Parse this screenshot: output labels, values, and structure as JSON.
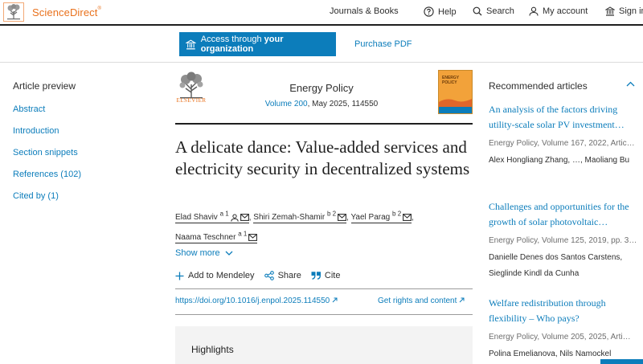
{
  "header": {
    "brand": "ScienceDirect",
    "brand_mark": "®",
    "nav": {
      "journals": "Journals & Books",
      "help": "Help",
      "search": "Search",
      "account": "My account",
      "signin": "Sign in"
    }
  },
  "access": {
    "button_prefix": "Access through ",
    "button_bold": "your organization",
    "purchase": "Purchase PDF"
  },
  "sidebar": {
    "title": "Article preview",
    "items": [
      {
        "label": "Abstract"
      },
      {
        "label": "Introduction"
      },
      {
        "label": "Section snippets"
      },
      {
        "label": "References (102)"
      },
      {
        "label": "Cited by (1)"
      }
    ]
  },
  "article": {
    "publisher_word": "ELSEVIER",
    "journal": "Energy Policy",
    "volume": "Volume 200",
    "volume_rest": ", May 2025, 114550",
    "cover_title": "ENERGY POLICY",
    "title": "A delicate dance: Value-added services and electricity security in decentralized systems",
    "authors": [
      {
        "name": "Elad Shaviv",
        "sup": "a 1"
      },
      {
        "name": "Shiri Zemah-Shamir",
        "sup": "b 2"
      },
      {
        "name": "Yael Parag",
        "sup": "b 2"
      },
      {
        "name": "Naama Teschner",
        "sup": "a 1"
      }
    ],
    "separator": ",",
    "show_more": "Show more",
    "actions": {
      "mendeley": "Add to Mendeley",
      "share": "Share",
      "cite": "Cite"
    },
    "doi": "https://doi.org/10.1016/j.enpol.2025.114550",
    "rights": "Get rights and content",
    "highlights": "Highlights"
  },
  "recommended": {
    "title": "Recommended articles",
    "items": [
      {
        "title": "An analysis of the factors driving utility-scale solar PV investment…",
        "meta": "Energy Policy, Volume 167, 2022, Artic…",
        "authors": "Alex Hongliang Zhang, …, Maoliang Bu"
      },
      {
        "title": "Challenges and opportunities for the growth of solar photovoltaic…",
        "meta": "Energy Policy, Volume 125, 2019, pp. 3…",
        "authors": "Danielle Denes dos Santos Carstens, Sieglinde Kindl da Cunha"
      },
      {
        "title": "Welfare redistribution through flexibility – Who pays?",
        "meta": "Energy Policy, Volume 205, 2025, Arti…",
        "authors": "Polina Emelianova, Nils Namockel"
      }
    ]
  },
  "colors": {
    "accent": "#0c7dbb",
    "brand": "#e9711c",
    "text": "#2e2e2e"
  }
}
